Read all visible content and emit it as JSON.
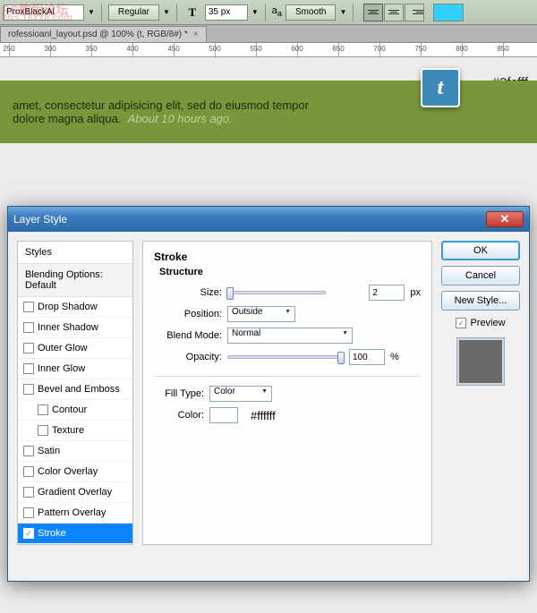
{
  "watermark": {
    "l1": "PS教程论坛",
    "l2": "bbs.16xx8.com"
  },
  "optbar": {
    "font": "ProxBlackAl",
    "weight": "Regular",
    "size": "35 px",
    "aa_label": "Smooth",
    "color_swatch": "#2fcfff"
  },
  "tab": {
    "label": "rofessioanl_layout.psd @ 100% (t, RGB/8#) *"
  },
  "ruler_ticks": [
    "250",
    "300",
    "350",
    "400",
    "450",
    "500",
    "550",
    "600",
    "650",
    "700",
    "750",
    "800",
    "850"
  ],
  "callout_color": "#2fcfff",
  "greenbar": {
    "text1": "amet, consectetur adipisicing elit, sed do eiusmod tempor",
    "text2": "dolore magna aliqua.",
    "timeago": "About 10 hours ago.",
    "tw_glyph": "t"
  },
  "dialog": {
    "title": "Layer Style",
    "styles_header": "Styles",
    "blending": "Blending Options: Default",
    "items": [
      {
        "label": "Drop Shadow",
        "chk": false
      },
      {
        "label": "Inner Shadow",
        "chk": false
      },
      {
        "label": "Outer Glow",
        "chk": false
      },
      {
        "label": "Inner Glow",
        "chk": false
      },
      {
        "label": "Bevel and Emboss",
        "chk": false
      },
      {
        "label": "Contour",
        "chk": false,
        "indent": true
      },
      {
        "label": "Texture",
        "chk": false,
        "indent": true
      },
      {
        "label": "Satin",
        "chk": false
      },
      {
        "label": "Color Overlay",
        "chk": false
      },
      {
        "label": "Gradient Overlay",
        "chk": false
      },
      {
        "label": "Pattern Overlay",
        "chk": false
      },
      {
        "label": "Stroke",
        "chk": true,
        "active": true
      }
    ],
    "panel": {
      "title": "Stroke",
      "section": "Structure",
      "size_label": "Size:",
      "size_value": "2",
      "size_unit": "px",
      "position_label": "Position:",
      "position_value": "Outside",
      "blend_label": "Blend Mode:",
      "blend_value": "Normal",
      "opacity_label": "Opacity:",
      "opacity_value": "100",
      "opacity_unit": "%",
      "fill_label": "Fill Type:",
      "fill_value": "Color",
      "color_label": "Color:",
      "color_hex": "#ffffff"
    },
    "buttons": {
      "ok": "OK",
      "cancel": "Cancel",
      "new_style": "New Style...",
      "preview": "Preview"
    }
  }
}
